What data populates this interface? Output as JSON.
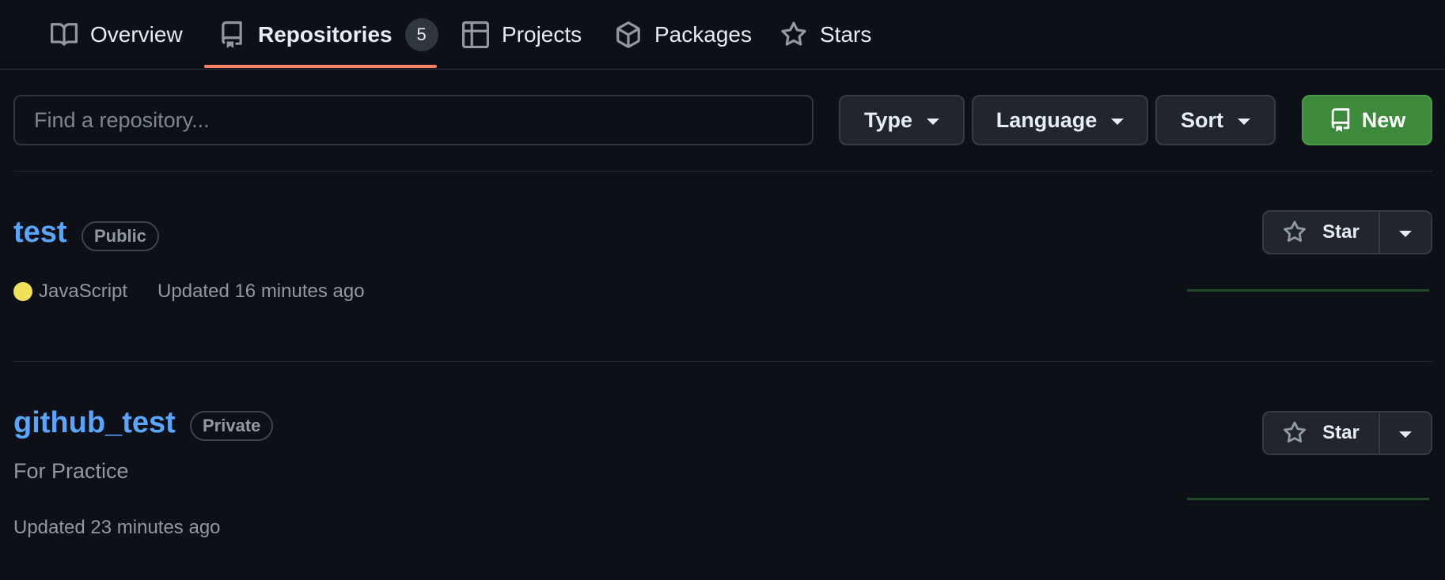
{
  "tabs": [
    {
      "label": "Overview",
      "icon": "book-icon"
    },
    {
      "label": "Repositories",
      "icon": "repo-icon",
      "count": "5",
      "selected": true
    },
    {
      "label": "Projects",
      "icon": "table-icon"
    },
    {
      "label": "Packages",
      "icon": "package-icon"
    },
    {
      "label": "Stars",
      "icon": "star-icon"
    }
  ],
  "filters": {
    "search_placeholder": "Find a repository...",
    "type_label": "Type",
    "language_label": "Language",
    "sort_label": "Sort",
    "new_label": "New"
  },
  "repos": [
    {
      "name": "test",
      "visibility": "Public",
      "description": "",
      "language": "JavaScript",
      "language_color": "#f1e05a",
      "updated": "Updated 16 minutes ago",
      "star_label": "Star"
    },
    {
      "name": "github_test",
      "visibility": "Private",
      "description": "For Practice",
      "language": "",
      "updated": "Updated 23 minutes ago",
      "star_label": "Star"
    }
  ],
  "colors": {
    "background": "#0d1117",
    "link": "#58a6ff",
    "accent_underline": "#f78166",
    "new_button": "#3e8a3c"
  }
}
